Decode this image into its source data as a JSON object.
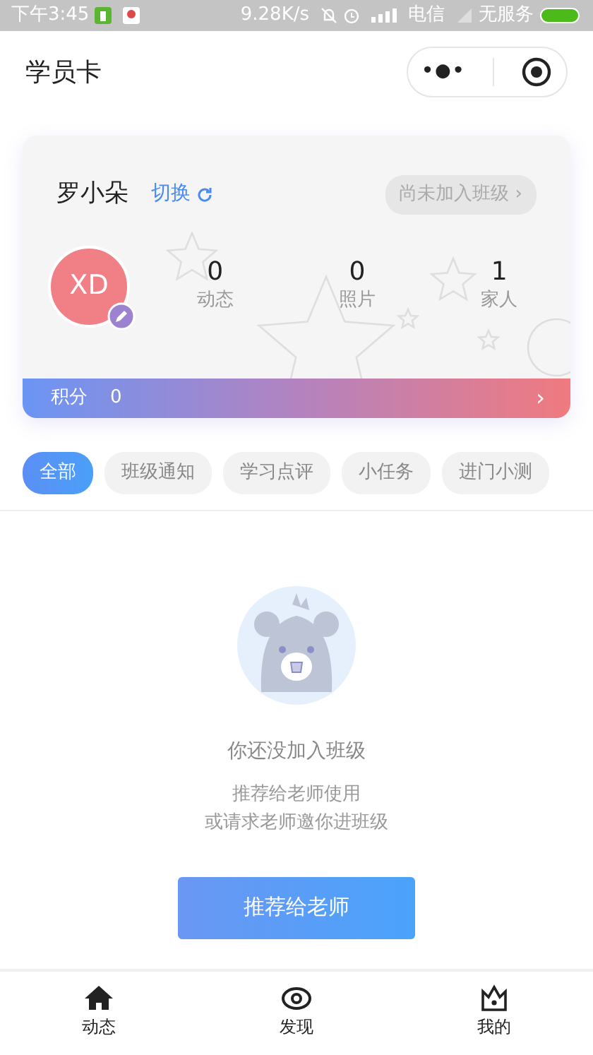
{
  "status_bar": {
    "time": "下午3:45",
    "speed": "9.28K/s",
    "carrier": "电信",
    "service": "无服务"
  },
  "header": {
    "title": "学员卡",
    "more_icon": "•●•"
  },
  "student_card": {
    "name": "罗小朵",
    "switch": "切换",
    "class_status": "尚未加入班级",
    "class_arrow": "›",
    "avatar": "XD",
    "stats": [
      {
        "value": "0",
        "label": "动态"
      },
      {
        "value": "0",
        "label": "照片"
      },
      {
        "value": "1",
        "label": "家人"
      }
    ],
    "points_label": "积分",
    "points": "0",
    "points_arrow": "›"
  },
  "filters": [
    {
      "label": "全部",
      "selected": true
    },
    {
      "label": "班级通知",
      "selected": false
    },
    {
      "label": "学习点评",
      "selected": false
    },
    {
      "label": "小任务",
      "selected": false
    },
    {
      "label": "进门小测",
      "selected": false
    }
  ],
  "empty_state": {
    "title": "你还没加入班级",
    "lines": [
      "推荐给老师使用",
      "或请求老师邀你进班级"
    ],
    "button": "推荐给老师"
  },
  "bottom_nav": [
    {
      "label": "动态",
      "kind": "home"
    },
    {
      "label": "发现",
      "kind": "eye"
    },
    {
      "label": "我的",
      "kind": "crown"
    }
  ]
}
